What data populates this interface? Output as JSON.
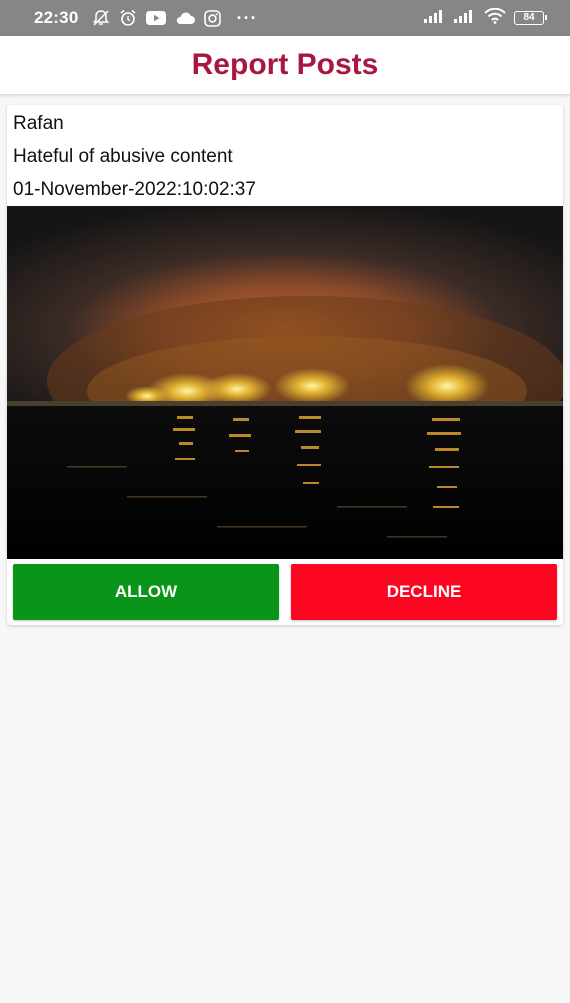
{
  "status_bar": {
    "time": "22:30",
    "battery": "84"
  },
  "app_bar": {
    "title": "Report Posts"
  },
  "post": {
    "user": "Rafan",
    "reason": "Hateful of abusive content",
    "datetime": "01-November-2022:10:02:37",
    "image_icon": "night-harbor-photo"
  },
  "actions": {
    "allow_label": "ALLOW",
    "decline_label": "DECLINE"
  },
  "colors": {
    "title": "#a8173f",
    "allow": "#0a9419",
    "decline": "#fc0521",
    "status_bar": "#868686"
  }
}
